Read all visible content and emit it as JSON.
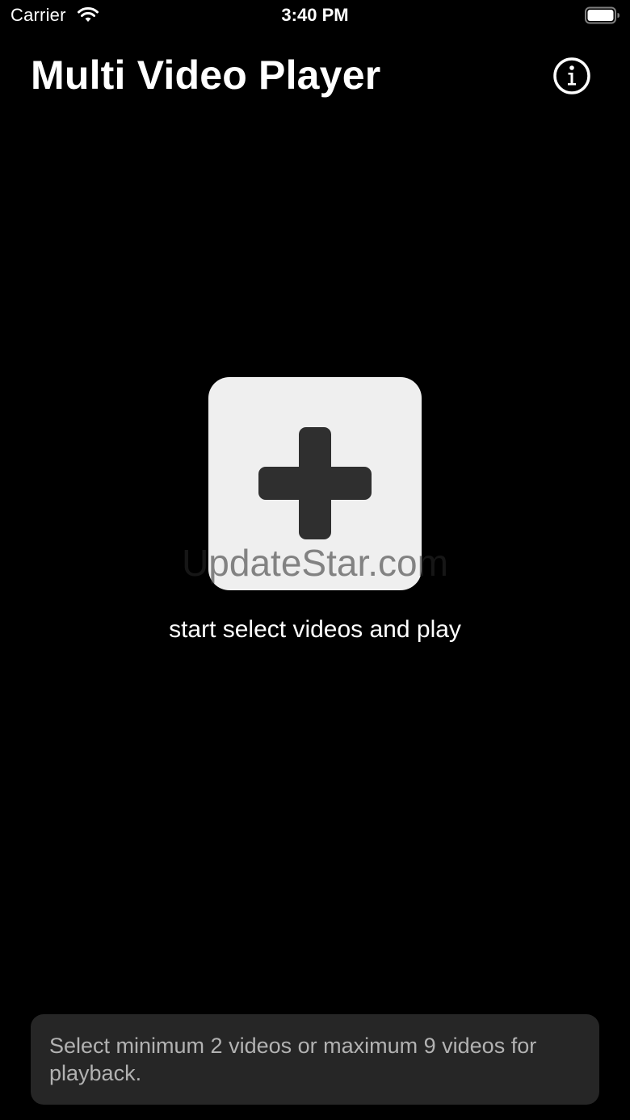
{
  "status_bar": {
    "carrier": "Carrier",
    "time": "3:40 PM",
    "wifi_icon": "wifi-icon",
    "battery_icon": "battery-icon"
  },
  "nav": {
    "title": "Multi Video Player",
    "info_icon": "info-icon"
  },
  "main": {
    "add_icon": "plus-icon",
    "hint": "start select videos and play",
    "watermark": "UpdateStar.com"
  },
  "toast": {
    "message": "Select minimum 2 videos or maximum 9 videos for playback."
  },
  "colors": {
    "background": "#000000",
    "tile": "#efefef",
    "plus": "#2f2f2f",
    "toast_bg": "#262626",
    "toast_text": "#b2b2b2"
  }
}
